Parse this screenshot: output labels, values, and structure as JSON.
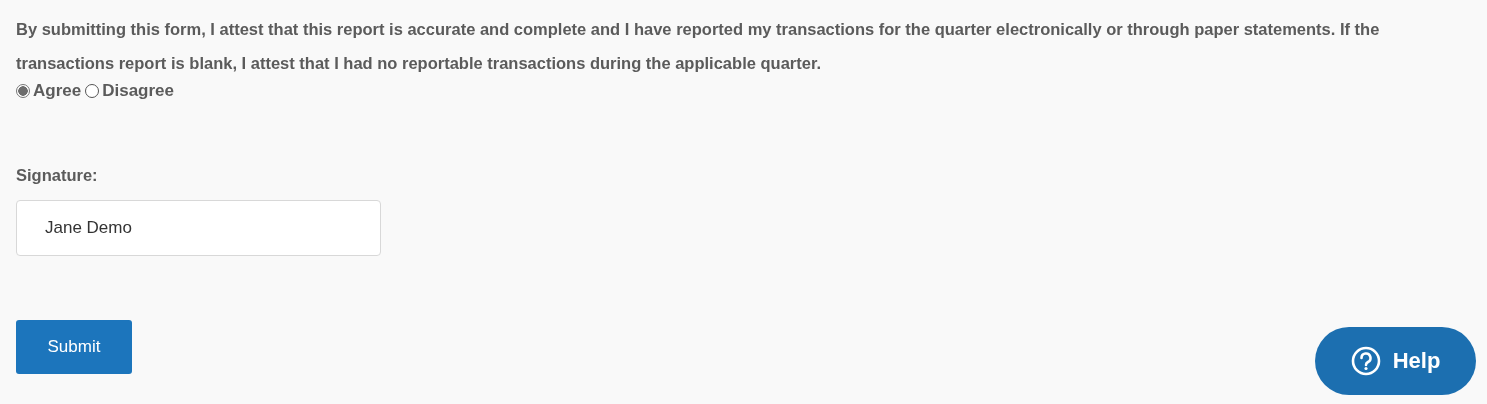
{
  "attestation": {
    "text": "By submitting this form, I attest that this report is accurate and complete and I have reported my transactions for the quarter electronically or through paper statements. If the transactions report is blank, I attest that I had no reportable transactions during the applicable quarter."
  },
  "options": [
    {
      "label": "Agree",
      "selected": true
    },
    {
      "label": "Disagree",
      "selected": false
    }
  ],
  "signature": {
    "label": "Signature:",
    "value": "Jane Demo"
  },
  "submit_button": {
    "label": "Submit"
  },
  "help_button": {
    "label": "Help"
  }
}
